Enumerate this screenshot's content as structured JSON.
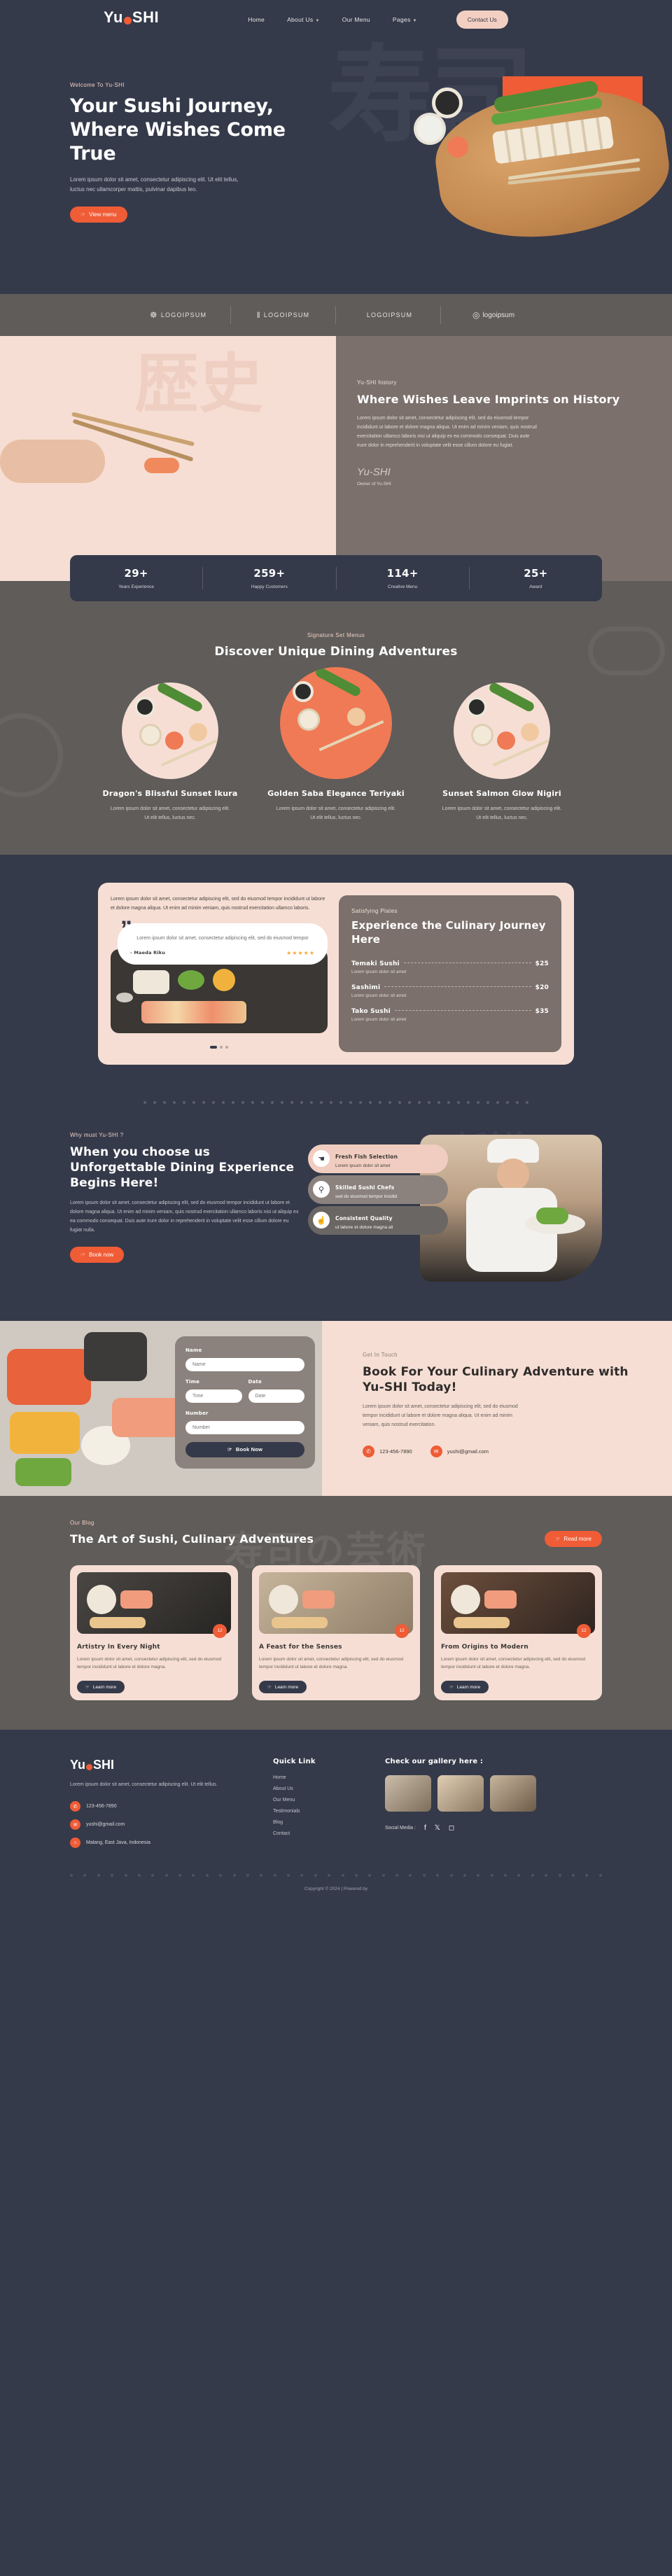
{
  "brand": {
    "name_pre": "Yu",
    "name_post": "SHI",
    "accent": "#ef5c36",
    "dark": "#353a4a",
    "pink": "#f6ded4"
  },
  "nav": {
    "items": [
      {
        "label": "Home",
        "caret": false
      },
      {
        "label": "About Us",
        "caret": true
      },
      {
        "label": "Our Menu",
        "caret": false
      },
      {
        "label": "Pages",
        "caret": true
      }
    ],
    "cta": "Contact Us"
  },
  "hero": {
    "eyebrow": "Welcome To Yu-SHI",
    "title": "Your Sushi Journey, Where Wishes Come True",
    "body": "Lorem ipsum dolor sit amet, consectetur adipiscing elit. Ut elit tellus, luctus nec ullamcorper mattis, pulvinar dapibus leo.",
    "cta": "View menu",
    "kanji": "寿司"
  },
  "brands": [
    {
      "mark": "☸",
      "label": "LOGOIPSUM"
    },
    {
      "mark": "‖",
      "label": "LOGOIPSUM"
    },
    {
      "mark": "",
      "label": "LOGOIPSUM"
    },
    {
      "mark": "◎",
      "label": "logoipsum"
    }
  ],
  "history": {
    "eyebrow": "Yu-SHI history",
    "title": "Where Wishes Leave Imprints on History",
    "body": "Lorem ipsum dolor sit amet, consectetur adipiscing elit, sed do eiusmod tempor incididunt ut labore et dolore magna aliqua. Ut enim ad minim veniam, quis nostrud exercitation ullamco laboris nisi ut aliquip ex ea commodo consequat. Duis aute irure dolor in reprehenderit in voluptate velit esse cillum dolore eu fugiat.",
    "signature": "Yu-SHI",
    "owner": "Owner of Yu-SHI",
    "kanji": "歴史"
  },
  "stats": [
    {
      "num": "29+",
      "label": "Years Experience"
    },
    {
      "num": "259+",
      "label": "Happy Customers"
    },
    {
      "num": "114+",
      "label": "Creative Menu"
    },
    {
      "num": "25+",
      "label": "Award"
    }
  ],
  "menu": {
    "eyebrow": "Signature Set Menus",
    "title": "Discover Unique Dining Adventures",
    "cards": [
      {
        "title": "Dragon's Blissful Sunset Ikura",
        "desc": "Lorem ipsum dolor sit amet, consectetur adipiscing elit. Ut elit tellus, luctus nec."
      },
      {
        "title": "Golden Saba Elegance Teriyaki",
        "desc": "Lorem ipsum dolor sit amet, consectetur adipiscing elit. Ut elit tellus, luctus nec."
      },
      {
        "title": "Sunset Salmon Glow Nigiri",
        "desc": "Lorem ipsum dolor sit amet, consectetur adipiscing elit. Ut elit tellus, luctus nec."
      }
    ]
  },
  "experience": {
    "intro": "Lorem ipsum dolor sit amet, consectetur adipiscing elit, sed do eiusmod tempor incididunt ut labore et dolore magna aliqua. Ut enim ad minim veniam, quis nostrud exercitation ullamco laboris.",
    "quote": "Lorem ipsum dolor sit amet, consectetur adipiscing elit, sed do eiusmod tempor",
    "author": "- Maeda Riku",
    "stars": "★★★★★",
    "eyebrow": "Satisfying Plates",
    "title": "Experience the Culinary Journey Here",
    "items": [
      {
        "name": "Temaki Sushi",
        "price": "$25",
        "desc": "Lorem ipsum dolor sit amet"
      },
      {
        "name": "Sashimi",
        "price": "$20",
        "desc": "Lorem ipsum dolor sit amet"
      },
      {
        "name": "Tako Sushi",
        "price": "$35",
        "desc": "Lorem ipsum dolor sit amet"
      }
    ]
  },
  "why": {
    "eyebrow": "Why must Yu-SHI ?",
    "title": "When you choose us Unforgettable Dining Experience Begins Here!",
    "body": "Lorem ipsum dolor sit amet, consectetur adipiscing elit, sed do eiusmod tempor incididunt ut labore et dolore magna aliqua. Ut enim ad minim veniam, quis nostrud exercitation ullamco laboris nisi ut aliquip ex ea commodo consequat. Duis aute irure dolor in reprehenderit in voluptate velit esse cillum dolore eu fugiat nulla.",
    "cta": "Book now",
    "kanji": "新鮮",
    "pills": [
      {
        "icon": "☚",
        "title": "Fresh Fish Selection",
        "sub": "Lorem ipsum dolor sit amet"
      },
      {
        "icon": "⚲",
        "title": "Skilled Sushi Chefs",
        "sub": "sed do eiusmod tempor incidid"
      },
      {
        "icon": "☝",
        "title": "Consistent Quality",
        "sub": "ut labore et dolore magna ali"
      }
    ]
  },
  "booking": {
    "form": {
      "name_label": "Name",
      "name_placeholder": "Name",
      "time_label": "Time",
      "time_placeholder": "Time",
      "date_label": "Date",
      "date_placeholder": "Date",
      "number_label": "Number",
      "number_placeholder": "Number",
      "submit": "Book Now"
    },
    "eyebrow": "Get In Touch",
    "title": "Book For Your Culinary Adventure with Yu-SHI Today!",
    "body": "Lorem ipsum dolor sit amet, consectetur adipiscing elit, sed do eiusmod tempor incididunt ut labore et dolore magna aliqua. Ut enim ad minim veniam, quis nostrud exercitation.",
    "phone": "123-456-7890",
    "email": "yushi@gmail.com"
  },
  "blog": {
    "eyebrow": "Our Blog",
    "title": "The Art of Sushi, Culinary Adventures",
    "cta": "Read more",
    "kanji": "寿司の芸術",
    "posts": [
      {
        "date": "12",
        "title": "Artistry In Every Night",
        "desc": "Lorem ipsum dolor sit amet, consectetur adipiscing elit, sed do eiusmod tempor incididunt ut labore et dolore magna.",
        "cta": "Learn more"
      },
      {
        "date": "12",
        "title": "A Feast for the Senses",
        "desc": "Lorem ipsum dolor sit amet, consectetur adipiscing elit, sed do eiusmod tempor incididunt ut labore et dolore magna.",
        "cta": "Learn more"
      },
      {
        "date": "12",
        "title": "From Origins to Modern",
        "desc": "Lorem ipsum dolor sit amet, consectetur adipiscing elit, sed do eiusmod tempor incididunt ut labore et dolore magna.",
        "cta": "Learn more"
      }
    ]
  },
  "footer": {
    "about": "Lorem ipsum dolor sit amet, consectetur adipiscing elit. Ut elit tellus.",
    "phone": "123-456-7890",
    "email": "yushi@gmail.com",
    "address": "Malang, East Java, Indonesia",
    "quick_title": "Quick Link",
    "quick_links": [
      "Home",
      "About Us",
      "Our Menu",
      "Testimonials",
      "Blog",
      "Contact"
    ],
    "gallery_title": "Check our gallery here :",
    "social_title": "Social Media :",
    "copyright": "Copyright © 2024 | Powered by"
  }
}
